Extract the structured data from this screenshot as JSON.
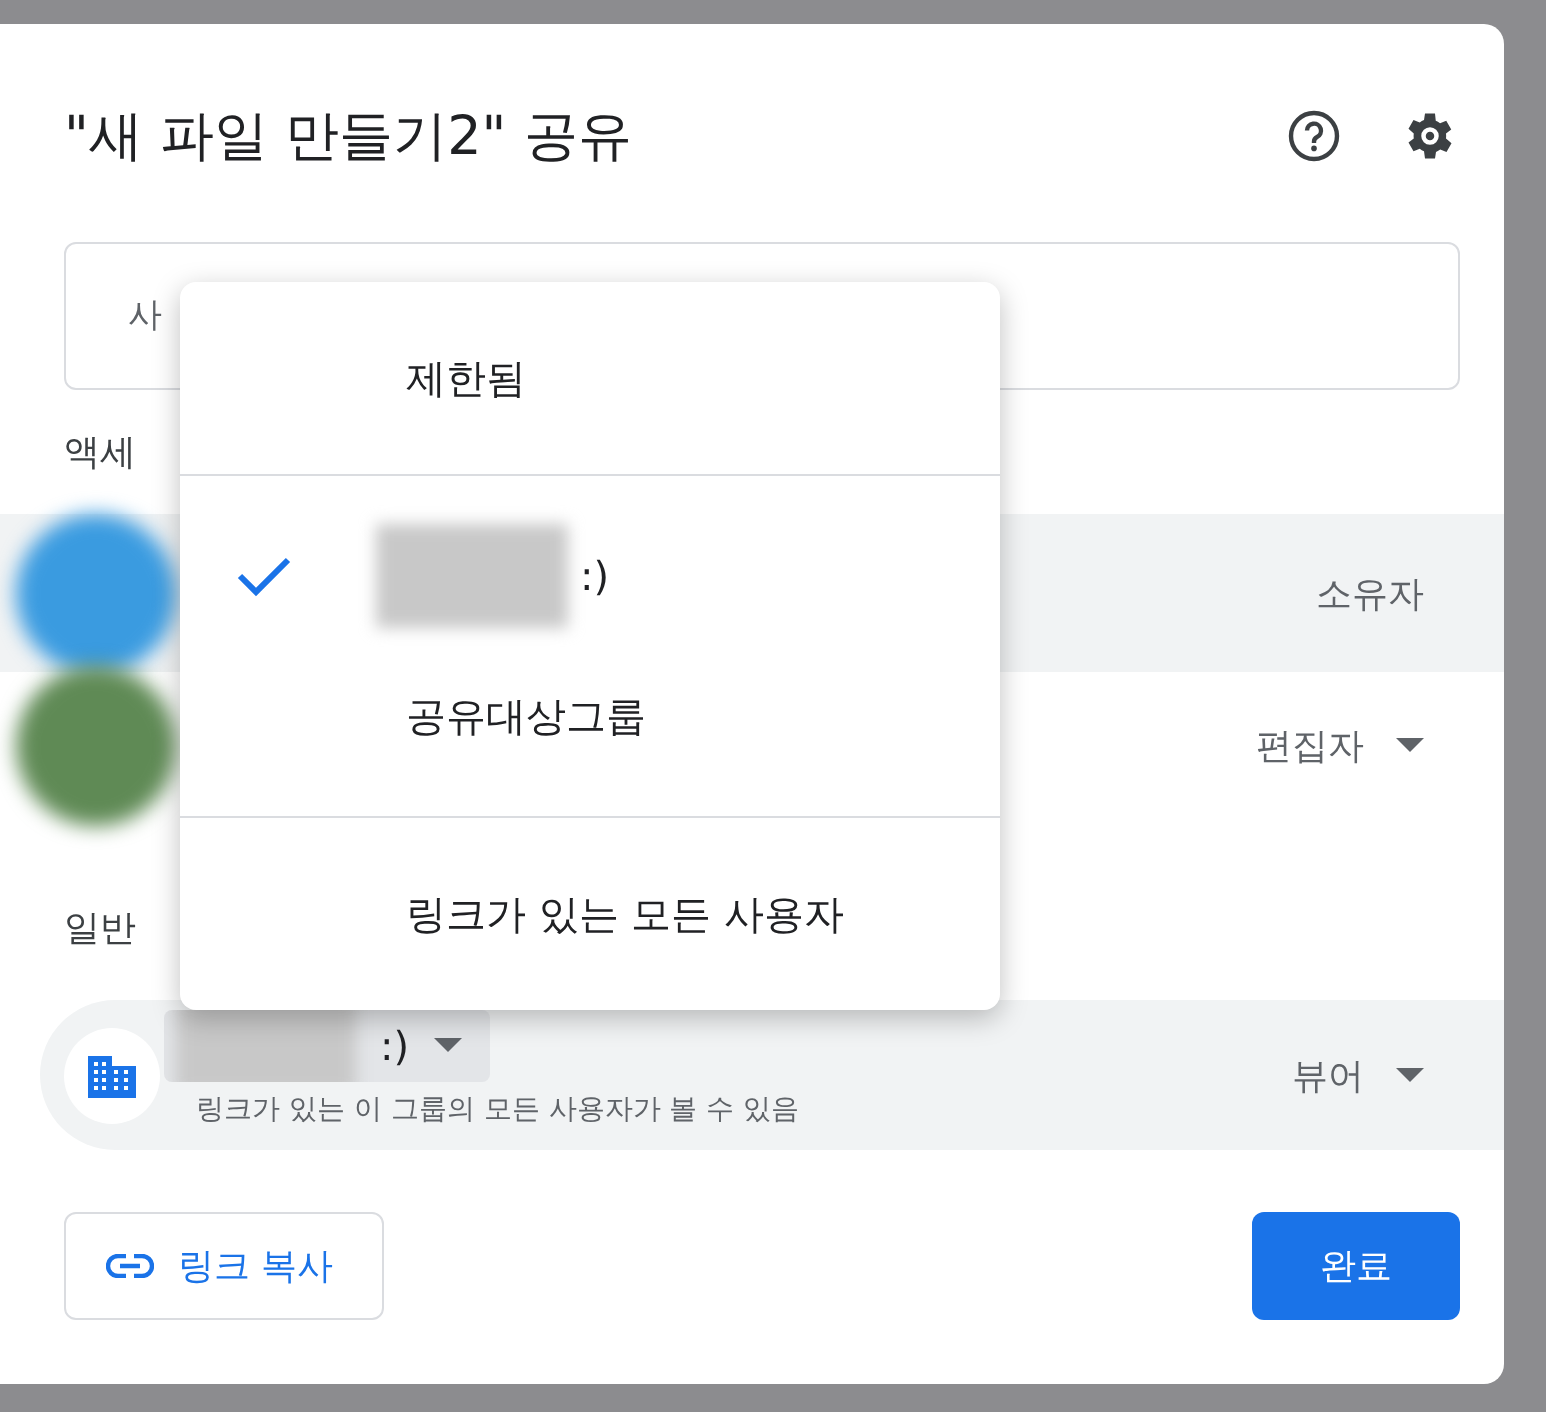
{
  "dialog": {
    "title": "\"새 파일 만들기2\" 공유",
    "add_people": {
      "placeholder": "사"
    },
    "access_heading": "액세",
    "people": [
      {
        "role": "소유자",
        "has_menu": false,
        "highlighted": true
      },
      {
        "role": "편집자",
        "has_menu": true,
        "highlighted": false
      }
    ],
    "general_heading": "일반",
    "general_access": {
      "option_suffix": ":)",
      "description": "링크가 있는 이 그룹의 모든 사용자가 볼 수 있음",
      "role": "뷰어"
    },
    "buttons": [
      {
        "label": "링크 복사",
        "kind": "outlined"
      },
      {
        "label": "완료",
        "kind": "primary"
      }
    ]
  },
  "menu": {
    "sections": [
      {
        "items": [
          {
            "label": "제한됨",
            "selected": false,
            "redacted": false
          }
        ]
      },
      {
        "items": [
          {
            "label": ":)",
            "selected": true,
            "redacted": true
          },
          {
            "label": "공유대상그룹",
            "selected": false,
            "redacted": false
          }
        ]
      },
      {
        "items": [
          {
            "label": "링크가 있는 모든 사용자",
            "selected": false,
            "redacted": false
          }
        ]
      }
    ]
  }
}
